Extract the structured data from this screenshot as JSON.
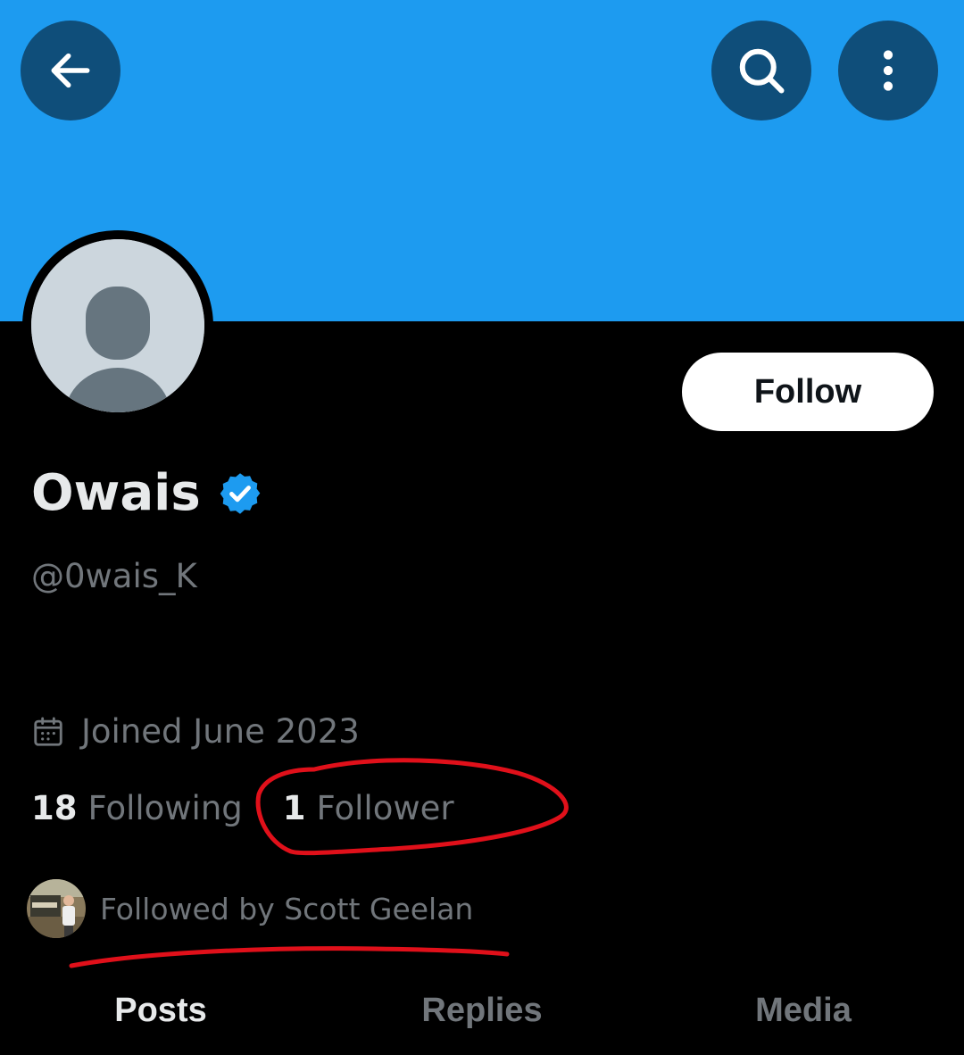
{
  "header": {
    "back_icon": "arrow-left-icon",
    "search_icon": "search-icon",
    "more_icon": "more-vertical-icon",
    "banner_color": "#1d9bf0"
  },
  "profile": {
    "display_name": "Owais",
    "verified_icon": "verified-badge-icon",
    "verified_color": "#1d9bf0",
    "handle": "@0wais_K",
    "follow_label": "Follow",
    "joined": "Joined June 2023",
    "calendar_icon": "calendar-icon",
    "following_count": "18",
    "following_label": "Following",
    "followers_count": "1",
    "followers_label": "Follower",
    "followed_by": "Followed by Scott Geelan"
  },
  "tabs": [
    {
      "label": "Posts",
      "active": true
    },
    {
      "label": "Replies",
      "active": false
    },
    {
      "label": "Media",
      "active": false
    }
  ],
  "annotation_color": "#e0101a"
}
